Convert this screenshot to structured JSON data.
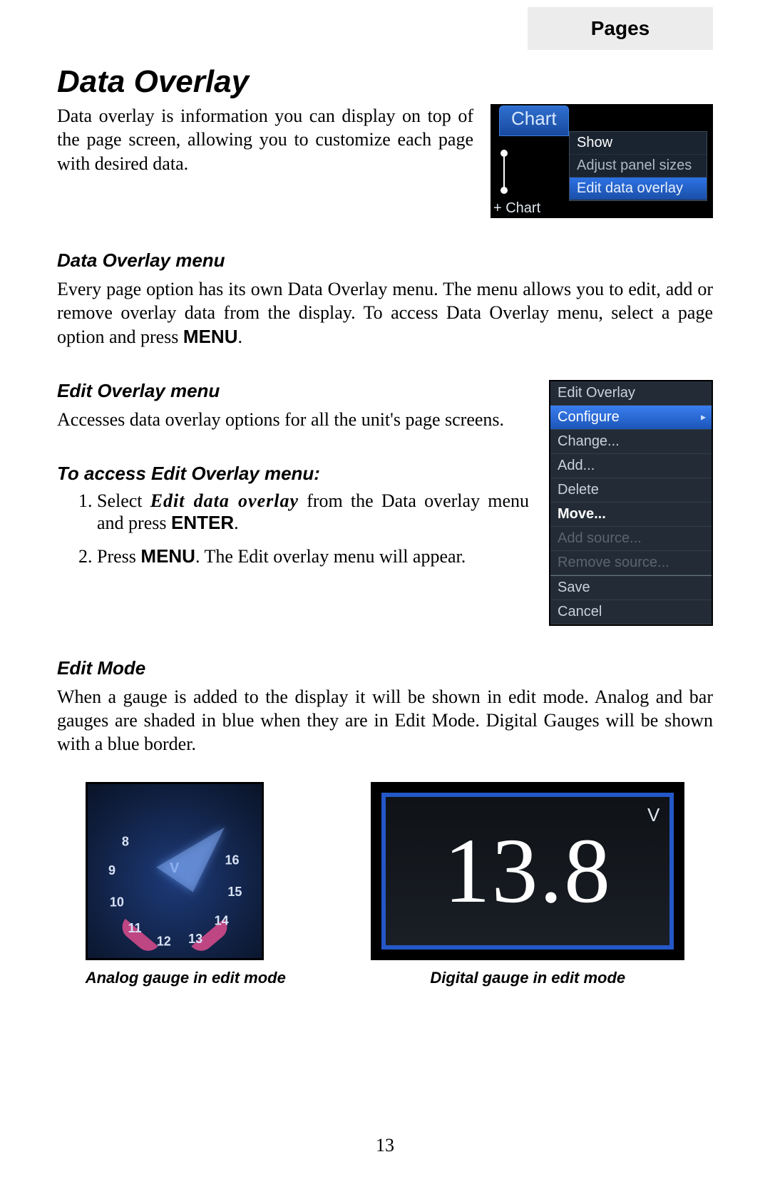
{
  "header": {
    "section": "Pages"
  },
  "title": "Data Overlay",
  "intro": "Data overlay is information you can display on top of the page screen, allowing you to customize each page with desired data.",
  "fig1": {
    "tab": "Chart",
    "row_show": "Show",
    "row_adjust": "Adjust panel sizes",
    "row_edit": "Edit data overlay",
    "bottom": "+ Chart"
  },
  "sec_data_overlay_menu": {
    "heading": "Data Overlay menu",
    "body_pre": "Every page option has its own Data Overlay menu. The menu allows you to edit, add or remove overlay data from the display.  To access Data Overlay menu, select a page option and press ",
    "menu_word": "MENU",
    "period": "."
  },
  "sec_edit_overlay_menu": {
    "heading": "Edit Overlay menu",
    "body": "Accesses data overlay options for all the unit's page screens."
  },
  "sec_to_access": {
    "heading": "To access Edit Overlay menu:",
    "step1_a": "Select ",
    "step1_em": "Edit data overlay",
    "step1_b": " from the Data overlay menu and press ",
    "step1_enter": "ENTER",
    "step1_c": ".",
    "step2_a": "Press ",
    "step2_menu": "MENU",
    "step2_b": ". The Edit overlay menu will appear."
  },
  "fig2": {
    "r0": "Edit Overlay",
    "r1": "Configure",
    "r2": "Change...",
    "r3": "Add...",
    "r4": "Delete",
    "r5": "Move...",
    "r6": "Add source...",
    "r7": "Remove source...",
    "r8": "Save",
    "r9": "Cancel"
  },
  "sec_edit_mode": {
    "heading": "Edit Mode",
    "body": "When a gauge is added to the display it will be shown in edit mode. Analog and bar gauges are shaded in blue when they are in Edit Mode. Digital Gauges will be shown with a blue border."
  },
  "gauges": {
    "analog": {
      "caption": "Analog gauge in edit mode",
      "center_label": "V",
      "ticks": [
        "8",
        "9",
        "10",
        "11",
        "12",
        "13",
        "14",
        "15",
        "16"
      ]
    },
    "digital": {
      "caption": "Digital gauge in edit mode",
      "value": "13.8",
      "unit": "V"
    }
  },
  "page_number": "13"
}
